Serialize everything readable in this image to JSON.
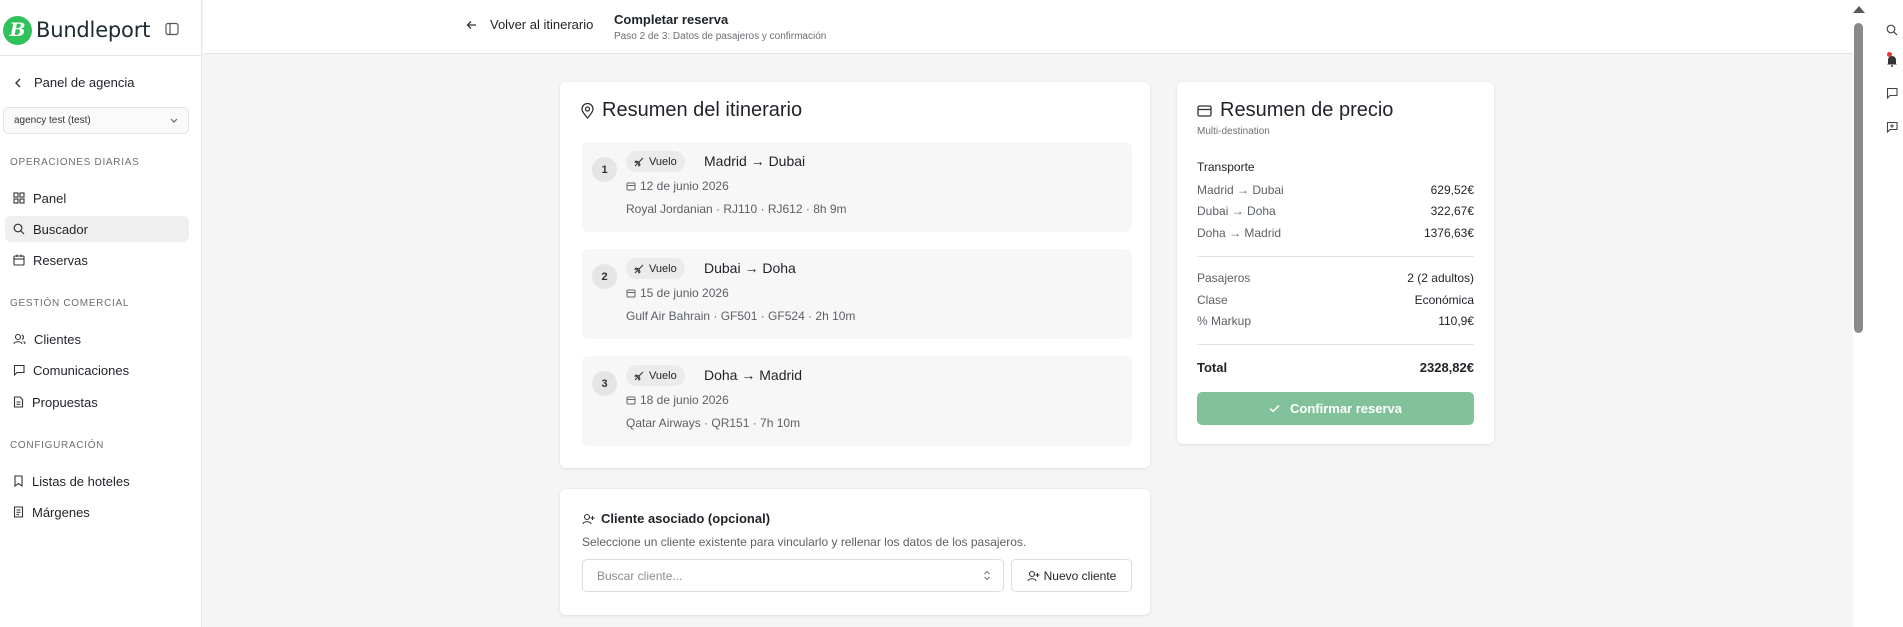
{
  "brand": {
    "name": "Bundleport",
    "logo_letter": "B",
    "color": "#2fc25b"
  },
  "sidebar": {
    "back_label": "Panel de agencia",
    "agency_select": "agency test (test)",
    "sections": [
      {
        "label": "OPERACIONES DIARIAS",
        "items": [
          {
            "label": "Panel",
            "icon": "dashboard-icon"
          },
          {
            "label": "Buscador",
            "icon": "search-icon",
            "active": true
          },
          {
            "label": "Reservas",
            "icon": "calendar-icon"
          }
        ]
      },
      {
        "label": "GESTIÓN COMERCIAL",
        "items": [
          {
            "label": "Clientes",
            "icon": "users-icon"
          },
          {
            "label": "Comunicaciones",
            "icon": "message-icon"
          },
          {
            "label": "Propuestas",
            "icon": "document-icon"
          }
        ]
      },
      {
        "label": "CONFIGURACIÓN",
        "items": [
          {
            "label": "Listas de hoteles",
            "icon": "bookmark-icon"
          },
          {
            "label": "Márgenes",
            "icon": "receipt-icon"
          }
        ]
      }
    ]
  },
  "header": {
    "back_label": "Volver al itinerario",
    "title": "Completar reserva",
    "subtitle": "Paso 2 de 3: Datos de pasajeros y confirmación"
  },
  "itinerary": {
    "title": "Resumen del itinerario",
    "legs": [
      {
        "num": "1",
        "type": "Vuelo",
        "route": "Madrid → Dubai",
        "date": "12 de junio 2026",
        "info": "Royal Jordanian · RJ110 · RJ612 · 8h 9m"
      },
      {
        "num": "2",
        "type": "Vuelo",
        "route": "Dubai → Doha",
        "date": "15 de junio 2026",
        "info": "Gulf Air Bahrain · GF501 · GF524 · 2h 10m"
      },
      {
        "num": "3",
        "type": "Vuelo",
        "route": "Doha → Madrid",
        "date": "18 de junio 2026",
        "info": "Qatar Airways · QR151 · 7h 10m"
      }
    ]
  },
  "price": {
    "title": "Resumen de precio",
    "subtitle": "Multi-destination",
    "transport_label": "Transporte",
    "transport_rows": [
      {
        "label": "Madrid → Dubai",
        "value": "629,52€"
      },
      {
        "label": "Dubai → Doha",
        "value": "322,67€"
      },
      {
        "label": "Doha → Madrid",
        "value": "1376,63€"
      }
    ],
    "detail_rows": [
      {
        "label": "Pasajeros",
        "value": "2 (2 adultos)"
      },
      {
        "label": "Clase",
        "value": "Económica"
      },
      {
        "label": "% Markup",
        "value": "110,9€"
      }
    ],
    "total_label": "Total",
    "total_value": "2328,82€",
    "confirm_label": "Confirmar reserva",
    "confirm_color": "#82c29a"
  },
  "client": {
    "title": "Cliente asociado (opcional)",
    "description": "Seleccione un cliente existente para vincularlo y rellenar los datos de los pasajeros.",
    "search_placeholder": "Buscar cliente...",
    "new_client_label": "Nuevo cliente"
  }
}
